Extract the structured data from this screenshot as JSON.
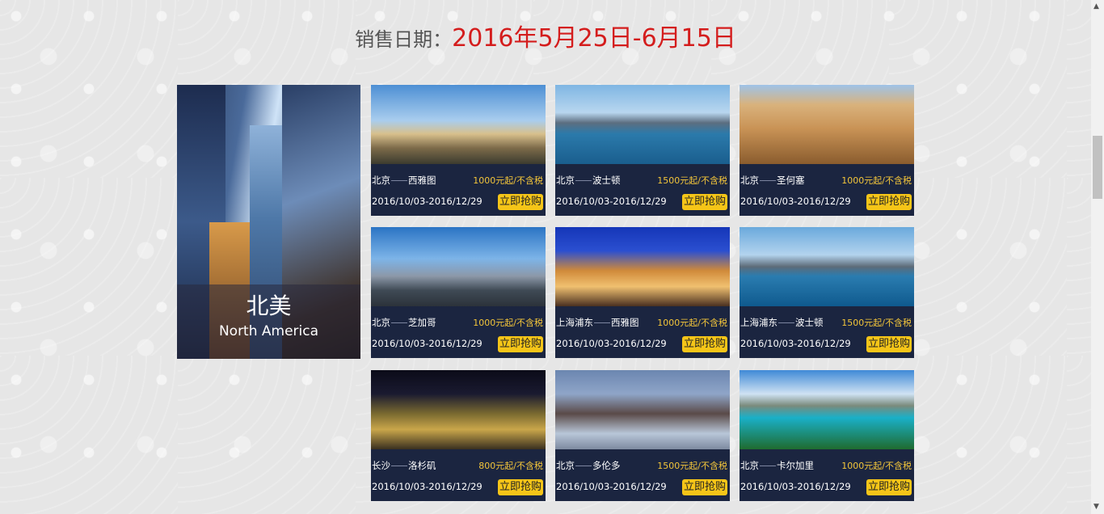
{
  "header": {
    "label": "销售日期：",
    "date_range": "2016年5月25日-6月15日"
  },
  "hero": {
    "title_cn": "北美",
    "title_en": "North America"
  },
  "cards": [
    {
      "from": "北京",
      "to": "西雅图",
      "price": "1000元起/不含税",
      "dates": "2016/10/03-2016/12/29",
      "buy": "立即抢购"
    },
    {
      "from": "北京",
      "to": "波士顿",
      "price": "1500元起/不含税",
      "dates": "2016/10/03-2016/12/29",
      "buy": "立即抢购"
    },
    {
      "from": "北京",
      "to": "圣何塞",
      "price": "1000元起/不含税",
      "dates": "2016/10/03-2016/12/29",
      "buy": "立即抢购"
    },
    {
      "from": "北京",
      "to": "芝加哥",
      "price": "1000元起/不含税",
      "dates": "2016/10/03-2016/12/29",
      "buy": "立即抢购"
    },
    {
      "from": "上海浦东",
      "to": "西雅图",
      "price": "1000元起/不含税",
      "dates": "2016/10/03-2016/12/29",
      "buy": "立即抢购"
    },
    {
      "from": "上海浦东",
      "to": "波士顿",
      "price": "1500元起/不含税",
      "dates": "2016/10/03-2016/12/29",
      "buy": "立即抢购"
    },
    {
      "from": "长沙",
      "to": "洛杉矶",
      "price": "800元起/不含税",
      "dates": "2016/10/03-2016/12/29",
      "buy": "立即抢购"
    },
    {
      "from": "北京",
      "to": "多伦多",
      "price": "1500元起/不含税",
      "dates": "2016/10/03-2016/12/29",
      "buy": "立即抢购"
    },
    {
      "from": "北京",
      "to": "卡尔加里",
      "price": "1000元起/不含税",
      "dates": "2016/10/03-2016/12/29",
      "buy": "立即抢购"
    }
  ],
  "icons": {
    "scroll_up": "scroll-up-arrow-icon",
    "scroll_down": "scroll-down-arrow-icon"
  },
  "colors": {
    "date_red": "#d41d1d",
    "card_bg": "#1b2540",
    "price_yellow": "#f4c63a",
    "button_yellow": "#f5c518"
  }
}
